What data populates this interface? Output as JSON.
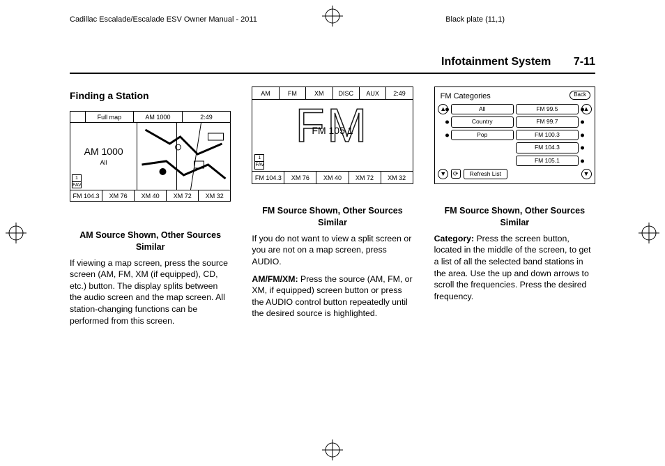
{
  "header": {
    "manual_title": "Cadillac Escalade/Escalade ESV Owner Manual - 2011",
    "plate": "Black plate (11,1)"
  },
  "running_head": {
    "section": "Infotainment System",
    "page": "7-11"
  },
  "col1": {
    "heading": "Finding a Station",
    "caption": "AM Source Shown, Other Sources Similar",
    "para": "If viewing a map screen, press the source screen (AM, FM, XM (if equipped), CD, etc.) button. The display splits between the audio screen and the map screen. All station-changing functions can be performed from this screen."
  },
  "col2": {
    "caption": "FM Source Shown, Other Sources Similar",
    "para1": "If you do not want to view a split screen or you are not on a map screen, press AUDIO.",
    "para2_label": "AM/FM/XM:",
    "para2": "  Press the source (AM, FM, or XM, if equipped) screen button or press the AUDIO control button repeatedly until the desired source is highlighted."
  },
  "col3": {
    "caption": "FM Source Shown, Other Sources Similar",
    "para_label": "Category:",
    "para": "  Press the screen button, located in the middle of the screen, to get a list of all the selected band stations in the area. Use the up and down arrows to scroll the frequencies. Press the desired frequency."
  },
  "diagram1": {
    "top": {
      "empty": "",
      "fullmap": "Full map",
      "station": "AM 1000",
      "time": "2:49"
    },
    "mid": {
      "big": "AM 1000",
      "small": "All"
    },
    "fav": {
      "n": "1",
      "lbl": "FAV"
    },
    "bottom": [
      "FM 104.3",
      "XM 76",
      "XM 40",
      "XM 72",
      "XM 32"
    ]
  },
  "diagram2": {
    "top": [
      "AM",
      "FM",
      "XM",
      "DISC",
      "AUX",
      "2:49"
    ],
    "big": "FM",
    "freq": "FM 105.1",
    "fav": {
      "n": "1",
      "lbl": "FAV"
    },
    "bottom": [
      "FM 104.3",
      "XM 76",
      "XM 40",
      "XM 72",
      "XM 32"
    ]
  },
  "diagram3": {
    "title": "FM Categories",
    "back": "Back",
    "cats": [
      "All",
      "Country",
      "Pop"
    ],
    "freqs": [
      "FM 99.5",
      "FM 99.7",
      "FM 100.3",
      "FM 104.3",
      "FM 105.1"
    ],
    "refresh": "Refresh List",
    "arrow_up": "▲",
    "arrow_dn": "▼",
    "cycle": "⟳"
  }
}
